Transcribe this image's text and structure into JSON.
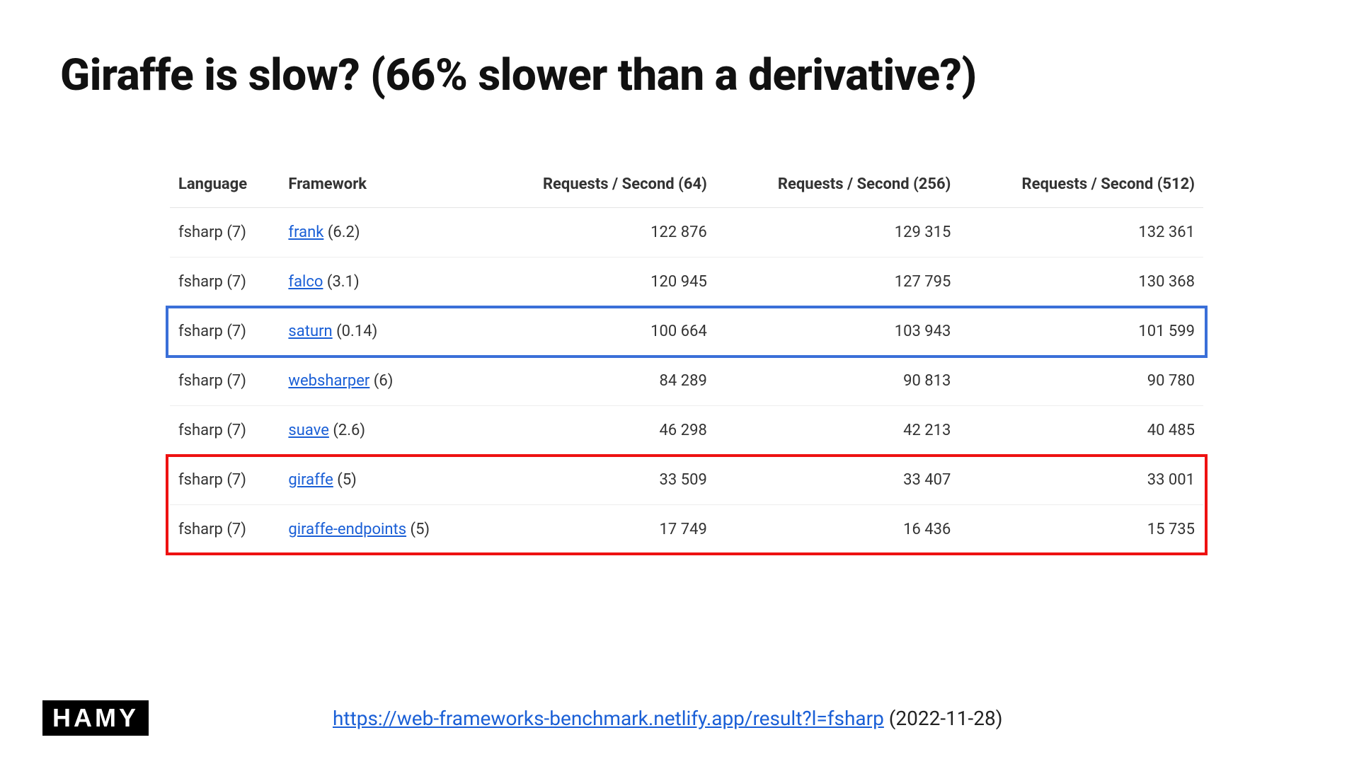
{
  "title": "Giraffe is slow? (66% slower than a derivative?)",
  "columns": {
    "language": "Language",
    "framework": "Framework",
    "rps64": "Requests / Second (64)",
    "rps256": "Requests / Second (256)",
    "rps512": "Requests / Second (512)"
  },
  "rows": [
    {
      "language": "fsharp (7)",
      "framework_name": "frank",
      "framework_ver": "(6.2)",
      "rps64": "122 876",
      "rps256": "129 315",
      "rps512": "132 361"
    },
    {
      "language": "fsharp (7)",
      "framework_name": "falco",
      "framework_ver": "(3.1)",
      "rps64": "120 945",
      "rps256": "127 795",
      "rps512": "130 368"
    },
    {
      "language": "fsharp (7)",
      "framework_name": "saturn",
      "framework_ver": "(0.14)",
      "rps64": "100 664",
      "rps256": "103 943",
      "rps512": "101 599"
    },
    {
      "language": "fsharp (7)",
      "framework_name": "websharper",
      "framework_ver": "(6)",
      "rps64": "84 289",
      "rps256": "90 813",
      "rps512": "90 780"
    },
    {
      "language": "fsharp (7)",
      "framework_name": "suave",
      "framework_ver": "(2.6)",
      "rps64": "46 298",
      "rps256": "42 213",
      "rps512": "40 485"
    },
    {
      "language": "fsharp (7)",
      "framework_name": "giraffe",
      "framework_ver": "(5)",
      "rps64": "33 509",
      "rps256": "33 407",
      "rps512": "33 001"
    },
    {
      "language": "fsharp (7)",
      "framework_name": "giraffe-endpoints",
      "framework_ver": "(5)",
      "rps64": "17 749",
      "rps256": "16 436",
      "rps512": "15 735"
    }
  ],
  "highlights": {
    "blue_row_index": 2,
    "red_row_start": 5,
    "red_row_end": 6
  },
  "logo_text": "HAMY",
  "source": {
    "url_text": "https://web-frameworks-benchmark.netlify.app/result?l=fsharp",
    "date_text": " (2022-11-28)"
  }
}
